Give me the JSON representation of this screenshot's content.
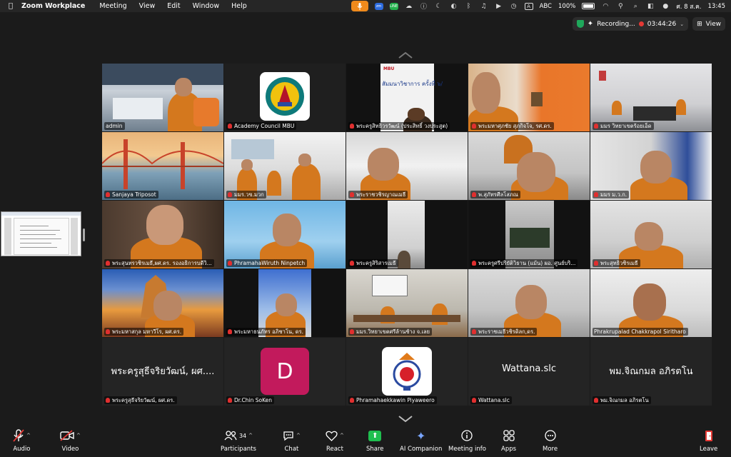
{
  "menubar": {
    "apple_icon": "apple-logo",
    "app_name": "Zoom Workplace",
    "menus": [
      "Meeting",
      "View",
      "Edit",
      "Window",
      "Help"
    ],
    "input_source": "ABC",
    "battery": "100%",
    "date": "ศ. 8 ส.ค.",
    "time": "13:45"
  },
  "status": {
    "recording_label": "Recording...",
    "elapsed": "03:44:26",
    "view_label": "View"
  },
  "tiles": [
    {
      "name": "admin",
      "kind": "video",
      "active": true
    },
    {
      "name": "Academy Council MBU",
      "kind": "logo"
    },
    {
      "name": "พระครูสิทธิวรวัฒน์ (ประสิทธิ์ วงประสูต)",
      "kind": "video",
      "slide_title": "MBU",
      "slide_text": "สัมมนาวิชาการ ครั้งที่ ๖/"
    },
    {
      "name": "พระมหาศุภชัย สุภกิจโจ, รศ.ดร.",
      "kind": "video"
    },
    {
      "name": "มมร วิทยาเขตร้อยเอ็ด",
      "kind": "video"
    },
    {
      "name": "Sanjaya Triposot",
      "kind": "video"
    },
    {
      "name": "มมร.วข.มวก",
      "kind": "video"
    },
    {
      "name": "พระราชวชิรญาณเมธี",
      "kind": "video"
    },
    {
      "name": "พ.สุภัทรศีลโสภณ",
      "kind": "video"
    },
    {
      "name": "มมร ม.ว.ก.",
      "kind": "video"
    },
    {
      "name": "พระสุนทรวชิรเมธี,ผศ.ดร. รองอธิการบดีวิ...",
      "kind": "video"
    },
    {
      "name": "PhramahaWiruth Ninpetch",
      "kind": "video"
    },
    {
      "name": "พระครูสิริสารเมธี",
      "kind": "video"
    },
    {
      "name": "พระครูศรีปริยัติวิธาน (แม้น) ผอ. ศูนย์บริ...",
      "kind": "video"
    },
    {
      "name": "พระสุทธิวชิรเมธี",
      "kind": "video"
    },
    {
      "name": "พระมหาสกุล มหาวีโร, ผศ.ดร.",
      "kind": "video"
    },
    {
      "name": "พระมหาธนภัทร อภิชาโน, ดร.",
      "kind": "video"
    },
    {
      "name": "มมร.วิทยาเขตศรีล้านช้าง จ.เลย",
      "kind": "video"
    },
    {
      "name": "พระราชเมธีวชิรดิลก,ดร.",
      "kind": "video"
    },
    {
      "name": "Phrakrupalad Chakkrapol Siritharo",
      "kind": "video"
    },
    {
      "name": "พระครูสุธีจริยวัฒน์, ผศ.ดร.",
      "kind": "text",
      "display": "พระครูสุธีจริยวัฒน์, ผศ...."
    },
    {
      "name": "Dr.Chin SoKen",
      "kind": "avatar",
      "initial": "D"
    },
    {
      "name": "Phramahaekkawin Piyaweero",
      "kind": "logo2"
    },
    {
      "name": "Wattana.slc",
      "kind": "text",
      "display": "Wattana.slc"
    },
    {
      "name": "พม.จิณกมล อภิรตโน",
      "kind": "text",
      "display": "พม.จิณกมล อภิรตโน"
    }
  ],
  "toolbar": {
    "audio": "Audio",
    "video": "Video",
    "participants": "Participants",
    "participants_count": "34",
    "chat": "Chat",
    "react": "React",
    "share": "Share",
    "ai_companion": "AI Companion",
    "meeting_info": "Meeting info",
    "apps": "Apps",
    "more": "More",
    "leave": "Leave"
  },
  "colors": {
    "active_speaker": "#2fd05a",
    "muted_mic": "#e02f2f",
    "share": "#1fbf4f",
    "leave": "#e53935",
    "avatar_d": "#c21a5c",
    "robe": "#d4781e"
  }
}
